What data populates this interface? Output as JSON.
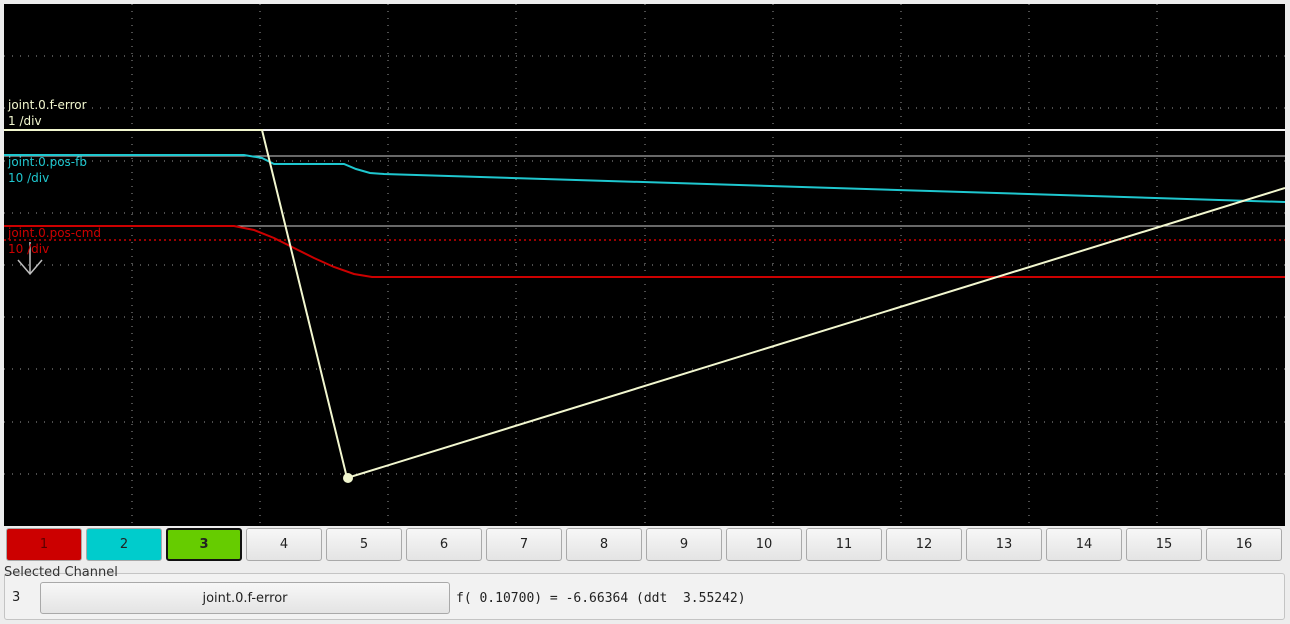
{
  "traces": [
    {
      "name": "joint.0.f-error",
      "scale": "1 /div",
      "color": "#f2f7cf"
    },
    {
      "name": "joint.0.pos-fb",
      "scale": "10 /div",
      "color": "#1fc7cf"
    },
    {
      "name": "joint.0.pos-cmd",
      "scale": "10 /div",
      "color": "#cc0000"
    }
  ],
  "channels": [
    {
      "label": "1",
      "color": "#cc0000"
    },
    {
      "label": "2",
      "color": "#00cccc"
    },
    {
      "label": "3",
      "color": "#66cc00",
      "selected": true
    },
    {
      "label": "4"
    },
    {
      "label": "5"
    },
    {
      "label": "6"
    },
    {
      "label": "7"
    },
    {
      "label": "8"
    },
    {
      "label": "9"
    },
    {
      "label": "10"
    },
    {
      "label": "11"
    },
    {
      "label": "12"
    },
    {
      "label": "13"
    },
    {
      "label": "14"
    },
    {
      "label": "15"
    },
    {
      "label": "16"
    }
  ],
  "selected_channel": {
    "section_label": "Selected Channel",
    "number": "3",
    "name": "joint.0.f-error",
    "readout": "f( 0.10700) = -6.66364 (ddt  3.55242)"
  },
  "colors": {
    "grid": "#9a9a9a",
    "baseline": "#d9d9d9",
    "trigger_level": "#cc0000"
  }
}
